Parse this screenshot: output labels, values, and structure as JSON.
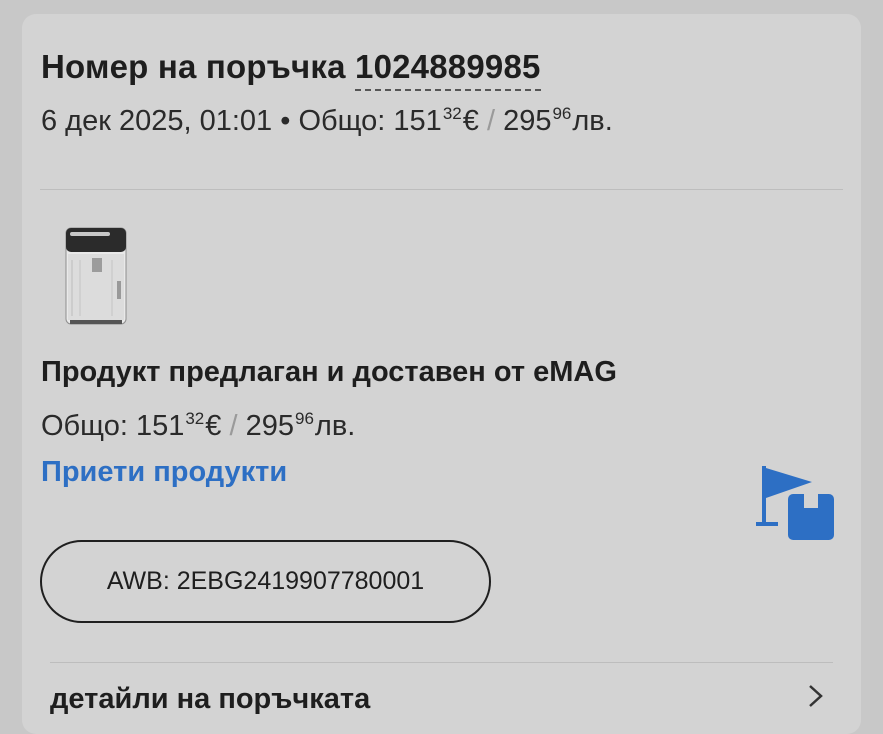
{
  "order": {
    "title_prefix": "Номер на поръчка",
    "number": "1024889985",
    "date": "6 дек 2025, 01:01",
    "total_label": "• Общо:",
    "eur_whole": "151",
    "eur_cents": "32",
    "eur_symbol": "€",
    "separator": "/",
    "bgn_whole": "295",
    "bgn_cents": "96",
    "bgn_symbol": "лв."
  },
  "product": {
    "image_icon": "dehumidifier-product-image",
    "seller_text": "Продукт предлаган и доставен от eMAG",
    "total_label": "Общо:",
    "eur_whole": "151",
    "eur_cents": "32",
    "eur_symbol": "€",
    "separator": "/",
    "bgn_whole": "295",
    "bgn_cents": "96",
    "bgn_symbol": "лв.",
    "status_link": "Приети продукти",
    "status_icon": "flag-package-icon",
    "status_color": "#2d6fc4"
  },
  "awb": {
    "label": "AWB: 2EBG2419907780001"
  },
  "details": {
    "label": "детайли на поръчката",
    "icon": "chevron-right-icon"
  }
}
